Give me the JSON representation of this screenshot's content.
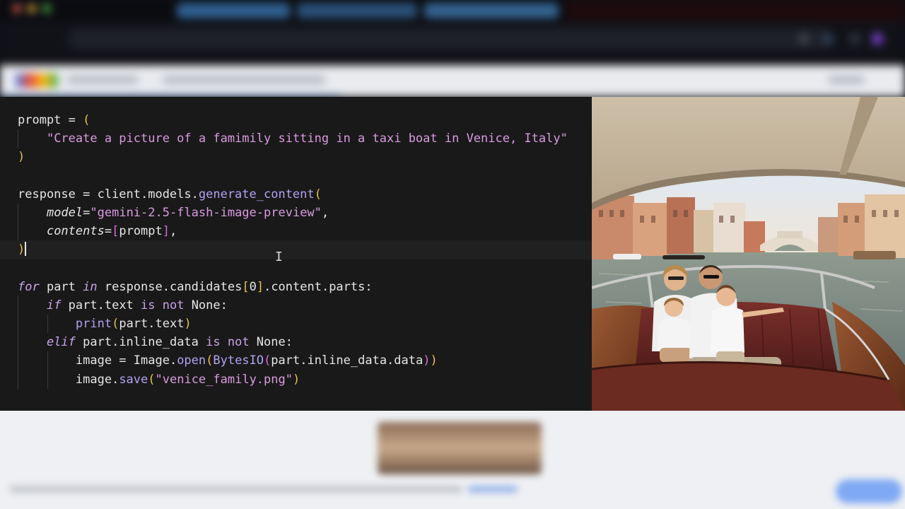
{
  "browser": {
    "tab_titles": [
      "",
      "",
      ""
    ],
    "address": "",
    "page_header_title": ""
  },
  "editor": {
    "lines": [
      {
        "indent": 0,
        "tokens": [
          {
            "t": "prompt = ",
            "c": "def"
          },
          {
            "t": "(",
            "c": "b1"
          }
        ]
      },
      {
        "indent": 1,
        "tokens": [
          {
            "t": "\"Create a picture of a famimily sitting in a taxi boat in Venice, Italy\"",
            "c": "str"
          }
        ]
      },
      {
        "indent": 0,
        "tokens": [
          {
            "t": ")",
            "c": "b1"
          }
        ]
      },
      {
        "indent": 0,
        "tokens": []
      },
      {
        "indent": 0,
        "tokens": [
          {
            "t": "response = client.models.",
            "c": "def"
          },
          {
            "t": "generate_content",
            "c": "fn"
          },
          {
            "t": "(",
            "c": "b1"
          }
        ]
      },
      {
        "indent": 1,
        "tokens": [
          {
            "t": "model",
            "c": "par"
          },
          {
            "t": "=",
            "c": "def"
          },
          {
            "t": "\"gemini-2.5-flash-image-preview\"",
            "c": "str"
          },
          {
            "t": ",",
            "c": "def"
          }
        ]
      },
      {
        "indent": 1,
        "tokens": [
          {
            "t": "contents",
            "c": "par"
          },
          {
            "t": "=",
            "c": "def"
          },
          {
            "t": "[",
            "c": "b2"
          },
          {
            "t": "prompt",
            "c": "def"
          },
          {
            "t": "]",
            "c": "b2"
          },
          {
            "t": ",",
            "c": "def"
          }
        ]
      },
      {
        "indent": 0,
        "current": true,
        "caret": true,
        "tokens": [
          {
            "t": ")",
            "c": "b1"
          }
        ]
      },
      {
        "indent": 0,
        "tokens": []
      },
      {
        "indent": 0,
        "tokens": [
          {
            "t": "for",
            "c": "kw"
          },
          {
            "t": " part ",
            "c": "def"
          },
          {
            "t": "in",
            "c": "kw"
          },
          {
            "t": " response.candidates",
            "c": "def"
          },
          {
            "t": "[",
            "c": "b1"
          },
          {
            "t": "0",
            "c": "def"
          },
          {
            "t": "]",
            "c": "b1"
          },
          {
            "t": ".content.parts:",
            "c": "def"
          }
        ]
      },
      {
        "indent": 1,
        "tokens": [
          {
            "t": "if",
            "c": "kw"
          },
          {
            "t": " part.text ",
            "c": "def"
          },
          {
            "t": "is not",
            "c": "kwp"
          },
          {
            "t": " None:",
            "c": "def"
          }
        ]
      },
      {
        "indent": 2,
        "tokens": [
          {
            "t": "print",
            "c": "fn"
          },
          {
            "t": "(",
            "c": "b1"
          },
          {
            "t": "part.text",
            "c": "def"
          },
          {
            "t": ")",
            "c": "b1"
          }
        ]
      },
      {
        "indent": 1,
        "tokens": [
          {
            "t": "elif",
            "c": "kw"
          },
          {
            "t": " part.inline_data ",
            "c": "def"
          },
          {
            "t": "is not",
            "c": "kwp"
          },
          {
            "t": " None:",
            "c": "def"
          }
        ]
      },
      {
        "indent": 2,
        "tokens": [
          {
            "t": "image = Image.",
            "c": "def"
          },
          {
            "t": "open",
            "c": "fn"
          },
          {
            "t": "(",
            "c": "b1"
          },
          {
            "t": "BytesIO",
            "c": "fn"
          },
          {
            "t": "(",
            "c": "b2"
          },
          {
            "t": "part.inline_data.data",
            "c": "def"
          },
          {
            "t": ")",
            "c": "b2"
          },
          {
            "t": ")",
            "c": "b1"
          }
        ]
      },
      {
        "indent": 2,
        "tokens": [
          {
            "t": "image.",
            "c": "def"
          },
          {
            "t": "save",
            "c": "fn"
          },
          {
            "t": "(",
            "c": "b1"
          },
          {
            "t": "\"venice_family.png\"",
            "c": "str"
          },
          {
            "t": ")",
            "c": "b1"
          }
        ]
      }
    ]
  },
  "generated_image": {
    "subject": "family-in-venice-taxi-boat-illustration"
  },
  "colors": {
    "editor_bg": "#191919",
    "string": "#d99be0",
    "bracket_yellow": "#e7c24b",
    "bracket_magenta": "#d96fd8",
    "function": "#b4a2f2",
    "keyword": "#c9a3e8"
  }
}
